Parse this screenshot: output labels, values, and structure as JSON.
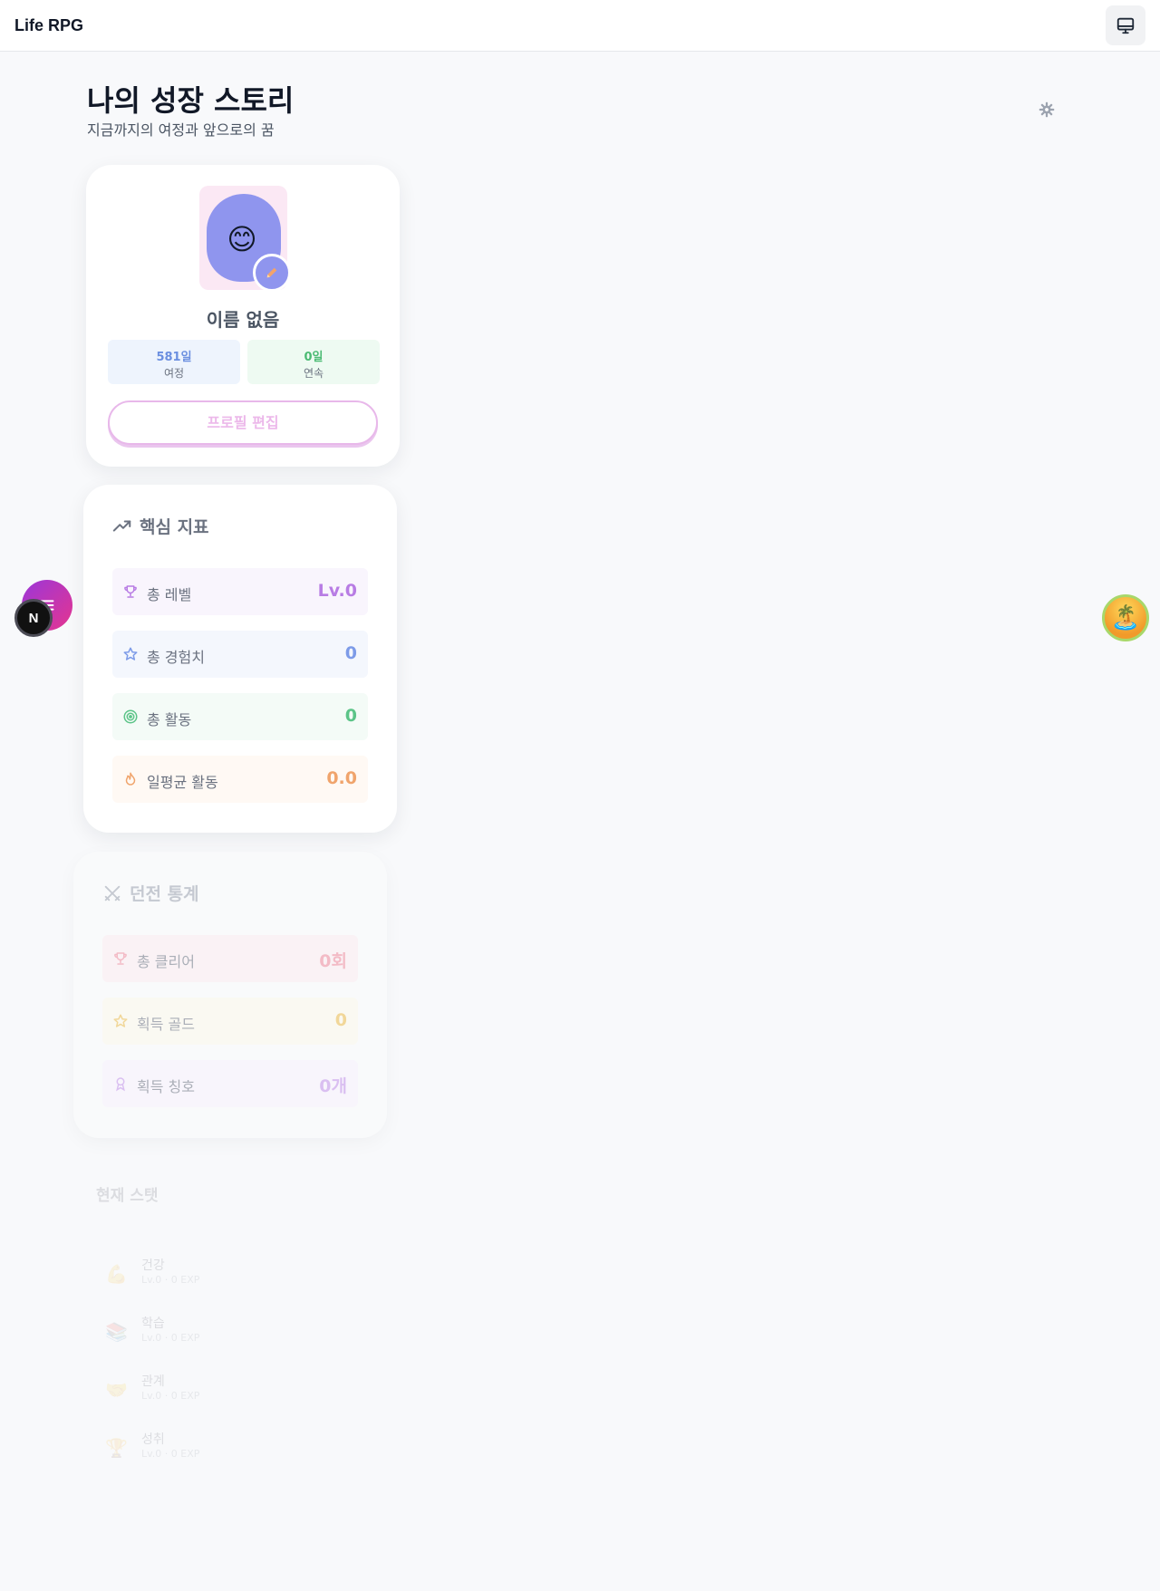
{
  "app": {
    "title": "Life RPG"
  },
  "header": {
    "title": "나의 성장 스토리",
    "subtitle": "지금까지의 여정과 앞으로의 꿈"
  },
  "profile": {
    "avatar_emoji": "😊",
    "name": "이름 없음",
    "journey": {
      "value": "581일",
      "label": "여정"
    },
    "streak": {
      "value": "0일",
      "label": "연속"
    },
    "edit_button": "프로필 편집"
  },
  "metrics": {
    "title": "핵심 지표",
    "items": [
      {
        "label": "총 레벨",
        "value": "Lv.0",
        "icon": "trophy-icon",
        "color": "#b87ce4",
        "bg": "#f9f5fd"
      },
      {
        "label": "총 경험치",
        "value": "0",
        "icon": "star-icon",
        "color": "#7d9be8",
        "bg": "#f4f7fd"
      },
      {
        "label": "총 활동",
        "value": "0",
        "icon": "target-icon",
        "color": "#5cc488",
        "bg": "#f4fbf7"
      },
      {
        "label": "일평균 활동",
        "value": "0.0",
        "icon": "flame-icon",
        "color": "#f0a46c",
        "bg": "#fff9f4"
      }
    ]
  },
  "dungeon": {
    "title": "던전 통계",
    "items": [
      {
        "label": "총 클리어",
        "value": "0회",
        "icon": "trophy-icon",
        "color": "#f08a9c",
        "bg": "#fdeef1"
      },
      {
        "label": "획득 골드",
        "value": "0",
        "icon": "star-icon",
        "color": "#ecbc4a",
        "bg": "#fdf9ec"
      },
      {
        "label": "획득 칭호",
        "value": "0개",
        "icon": "medal-icon",
        "color": "#c291ea",
        "bg": "#f8f2fd"
      }
    ]
  },
  "stats": {
    "title": "현재 스탯",
    "items": [
      {
        "icon": "💪",
        "name": "건강",
        "desc": "Lv.0 · 0 EXP"
      },
      {
        "icon": "📚",
        "name": "학습",
        "desc": "Lv.0 · 0 EXP"
      },
      {
        "icon": "🤝",
        "name": "관계",
        "desc": "Lv.0 · 0 EXP"
      },
      {
        "icon": "🏆",
        "name": "성취",
        "desc": "Lv.0 · 0 EXP"
      }
    ]
  },
  "fab": {
    "n_label": "N",
    "island_emoji": "🏝️"
  }
}
